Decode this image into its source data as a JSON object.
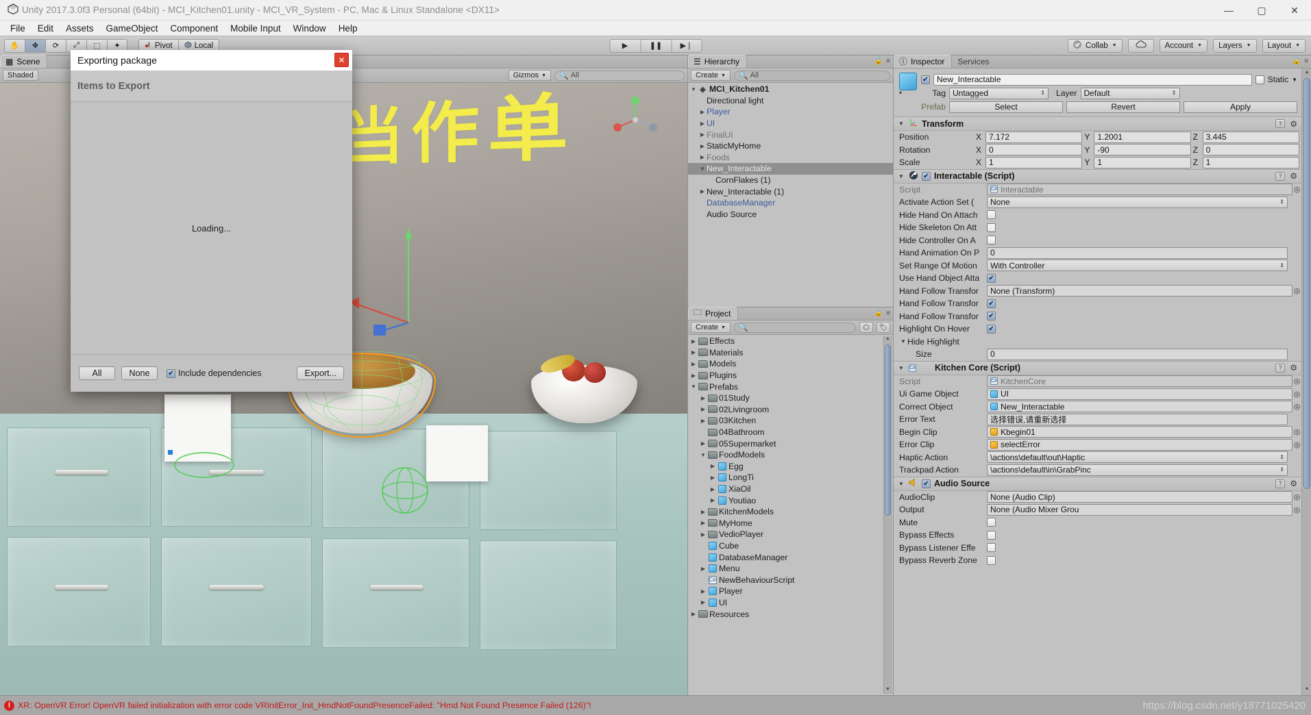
{
  "window": {
    "title": "Unity 2017.3.0f3 Personal (64bit) - MCI_Kitchen01.unity - MCI_VR_System - PC, Mac & Linux Standalone <DX11>",
    "logo_icon": "unity-logo-icon",
    "minimize": "—",
    "maximize": "▢",
    "close": "✕"
  },
  "menubar": [
    "File",
    "Edit",
    "Assets",
    "GameObject",
    "Component",
    "Mobile Input",
    "Window",
    "Help"
  ],
  "toolbar": {
    "tools": [
      {
        "name": "hand-tool",
        "glyph": "✋",
        "active": false
      },
      {
        "name": "move-tool",
        "glyph": "✥",
        "active": true
      },
      {
        "name": "rotate-tool",
        "glyph": "⟳",
        "active": false
      },
      {
        "name": "scale-tool",
        "glyph": "⤢",
        "active": false
      },
      {
        "name": "rect-tool",
        "glyph": "⬚",
        "active": false
      },
      {
        "name": "transform-tool",
        "glyph": "✦",
        "active": false
      }
    ],
    "pivot": "Pivot",
    "local": "Local",
    "play": "▶",
    "pause": "❚❚",
    "step": "▶❘",
    "collab": "Collab",
    "cloud_icon": "cloud-icon",
    "account": "Account",
    "layers": "Layers",
    "layout": "Layout"
  },
  "scene": {
    "tab": "Scene",
    "shading_mode": "Shaded",
    "gizmos": "Gizmos",
    "search_placeholder": "All",
    "wall_text": "一份当作单"
  },
  "hierarchy": {
    "tab": "Hierarchy",
    "create": "Create",
    "search_placeholder": "All",
    "items": [
      {
        "label": "MCI_Kitchen01",
        "depth": 0,
        "arrow": "▼",
        "icon": "unity-scene-icon",
        "style": "root"
      },
      {
        "label": "Directional light",
        "depth": 1,
        "arrow": "",
        "icon": "",
        "style": "normal"
      },
      {
        "label": "Player",
        "depth": 1,
        "arrow": "▶",
        "icon": "",
        "style": "prefab"
      },
      {
        "label": "UI",
        "depth": 1,
        "arrow": "▶",
        "icon": "",
        "style": "prefab"
      },
      {
        "label": "FinalUI",
        "depth": 1,
        "arrow": "▶",
        "icon": "",
        "style": "prefab-dim"
      },
      {
        "label": "StaticMyHome",
        "depth": 1,
        "arrow": "▶",
        "icon": "",
        "style": "normal"
      },
      {
        "label": "Foods",
        "depth": 1,
        "arrow": "▶",
        "icon": "",
        "style": "dim"
      },
      {
        "label": "New_Interactable",
        "depth": 1,
        "arrow": "▼",
        "icon": "",
        "style": "selected"
      },
      {
        "label": "CornFlakes (1)",
        "depth": 2,
        "arrow": "",
        "icon": "",
        "style": "normal"
      },
      {
        "label": "New_Interactable (1)",
        "depth": 1,
        "arrow": "▶",
        "icon": "",
        "style": "normal"
      },
      {
        "label": "DatabaseManager",
        "depth": 1,
        "arrow": "",
        "icon": "",
        "style": "prefab"
      },
      {
        "label": "Audio Source",
        "depth": 1,
        "arrow": "",
        "icon": "",
        "style": "normal"
      }
    ]
  },
  "project": {
    "tab": "Project",
    "create": "Create",
    "search_placeholder": "",
    "items": [
      {
        "label": "Effects",
        "depth": 0,
        "arrow": "▶",
        "icon": "folder"
      },
      {
        "label": "Materials",
        "depth": 0,
        "arrow": "▶",
        "icon": "folder"
      },
      {
        "label": "Models",
        "depth": 0,
        "arrow": "▶",
        "icon": "folder"
      },
      {
        "label": "Plugins",
        "depth": 0,
        "arrow": "▶",
        "icon": "folder"
      },
      {
        "label": "Prefabs",
        "depth": 0,
        "arrow": "▼",
        "icon": "folder"
      },
      {
        "label": "01Study",
        "depth": 1,
        "arrow": "▶",
        "icon": "folder"
      },
      {
        "label": "02Livingroom",
        "depth": 1,
        "arrow": "▶",
        "icon": "folder"
      },
      {
        "label": "03Kitchen",
        "depth": 1,
        "arrow": "▶",
        "icon": "folder"
      },
      {
        "label": "04Bathroom",
        "depth": 1,
        "arrow": "",
        "icon": "folder"
      },
      {
        "label": "05Supermarket",
        "depth": 1,
        "arrow": "▶",
        "icon": "folder"
      },
      {
        "label": "FoodModels",
        "depth": 1,
        "arrow": "▼",
        "icon": "folder"
      },
      {
        "label": "Egg",
        "depth": 2,
        "arrow": "▶",
        "icon": "prefab"
      },
      {
        "label": "LongTi",
        "depth": 2,
        "arrow": "▶",
        "icon": "prefab"
      },
      {
        "label": "XiaOil",
        "depth": 2,
        "arrow": "▶",
        "icon": "prefab"
      },
      {
        "label": "Youtiao",
        "depth": 2,
        "arrow": "▶",
        "icon": "prefab"
      },
      {
        "label": "KitchenModels",
        "depth": 1,
        "arrow": "▶",
        "icon": "folder"
      },
      {
        "label": "MyHome",
        "depth": 1,
        "arrow": "▶",
        "icon": "folder"
      },
      {
        "label": "VedioPlayer",
        "depth": 1,
        "arrow": "▶",
        "icon": "folder"
      },
      {
        "label": "Cube",
        "depth": 1,
        "arrow": "",
        "icon": "prefab"
      },
      {
        "label": "DatabaseManager",
        "depth": 1,
        "arrow": "",
        "icon": "prefab"
      },
      {
        "label": "Menu",
        "depth": 1,
        "arrow": "▶",
        "icon": "prefab"
      },
      {
        "label": "NewBehaviourScript",
        "depth": 1,
        "arrow": "",
        "icon": "script"
      },
      {
        "label": "Player",
        "depth": 1,
        "arrow": "▶",
        "icon": "prefab"
      },
      {
        "label": "UI",
        "depth": 1,
        "arrow": "▶",
        "icon": "prefab"
      },
      {
        "label": "Resources",
        "depth": 0,
        "arrow": "▶",
        "icon": "folder"
      }
    ]
  },
  "inspector": {
    "tab": "Inspector",
    "services_tab": "Services",
    "object_name": "New_Interactable",
    "enabled": true,
    "static_label": "Static",
    "tag_label": "Tag",
    "tag_value": "Untagged",
    "layer_label": "Layer",
    "layer_value": "Default",
    "prefab_label": "Prefab",
    "prefab_buttons": [
      "Select",
      "Revert",
      "Apply"
    ],
    "transform": {
      "title": "Transform",
      "rows": [
        {
          "name": "Position",
          "x": "7.172",
          "y": "1.2001",
          "z": "3.445"
        },
        {
          "name": "Rotation",
          "x": "0",
          "y": "-90",
          "z": "0"
        },
        {
          "name": "Scale",
          "x": "1",
          "y": "1",
          "z": "1"
        }
      ]
    },
    "interactable": {
      "title": "Interactable (Script)",
      "enabled": true,
      "props": [
        {
          "name": "Script",
          "type": "object-dim",
          "value": "Interactable",
          "icon": "script-dim"
        },
        {
          "name": "Activate Action Set (",
          "type": "dropdown",
          "value": "None"
        },
        {
          "name": "Hide Hand On Attach",
          "type": "checkbox",
          "value": false
        },
        {
          "name": "Hide Skeleton On Att",
          "type": "checkbox",
          "value": false
        },
        {
          "name": "Hide Controller On A",
          "type": "checkbox",
          "value": false
        },
        {
          "name": "Hand Animation On P",
          "type": "text",
          "value": "0"
        },
        {
          "name": "Set Range Of Motion",
          "type": "dropdown",
          "value": "With Controller"
        },
        {
          "name": "Use Hand Object Atta",
          "type": "checkbox",
          "value": true
        },
        {
          "name": "Hand Follow Transfor",
          "type": "object",
          "value": "None (Transform)"
        },
        {
          "name": "Hand Follow Transfor",
          "type": "checkbox",
          "value": true
        },
        {
          "name": "Hand Follow Transfor",
          "type": "checkbox",
          "value": true
        },
        {
          "name": "Highlight On Hover",
          "type": "checkbox",
          "value": true
        },
        {
          "name": "Hide Highlight",
          "type": "foldout",
          "value": ""
        },
        {
          "name": "Size",
          "type": "text-indent",
          "value": "0"
        }
      ]
    },
    "kitchen_core": {
      "title": "Kitchen Core (Script)",
      "props": [
        {
          "name": "Script",
          "type": "object-dim",
          "value": "KitchenCore",
          "icon": "script-dim"
        },
        {
          "name": "Ui Game Object",
          "type": "object-cube",
          "value": "UI"
        },
        {
          "name": "Correct Object",
          "type": "object-cube",
          "value": "New_Interactable"
        },
        {
          "name": "Error Text",
          "type": "text",
          "value": "选择错误,请重新选择"
        },
        {
          "name": "Begin Clip",
          "type": "object-audio",
          "value": "Kbegin01"
        },
        {
          "name": "Error Clip",
          "type": "object-audio",
          "value": "selectError"
        },
        {
          "name": "Haptic Action",
          "type": "dropdown",
          "value": "\\actions\\default\\out\\Haptic"
        },
        {
          "name": "Trackpad Action",
          "type": "dropdown",
          "value": "\\actions\\default\\in\\GrabPinc"
        }
      ]
    },
    "audio_source": {
      "title": "Audio Source",
      "enabled": true,
      "props": [
        {
          "name": "AudioClip",
          "type": "object",
          "value": "None (Audio Clip)"
        },
        {
          "name": "Output",
          "type": "object",
          "value": "None (Audio Mixer Grou"
        },
        {
          "name": "Mute",
          "type": "checkbox",
          "value": false
        },
        {
          "name": "Bypass Effects",
          "type": "checkbox",
          "value": false
        },
        {
          "name": "Bypass Listener Effe",
          "type": "checkbox",
          "value": false
        },
        {
          "name": "Bypass Reverb Zone",
          "type": "checkbox",
          "value": false
        }
      ]
    }
  },
  "dialog": {
    "title": "Exporting package",
    "close": "✕",
    "section": "Items to Export",
    "loading": "Loading...",
    "all_button": "All",
    "none_button": "None",
    "include_deps": "Include dependencies",
    "include_deps_checked": true,
    "export_button": "Export..."
  },
  "statusbar": {
    "error_icon": "error-icon",
    "error_badge": "!",
    "message": "XR: OpenVR Error! OpenVR failed initialization with error code VRInitError_Init_HmdNotFoundPresenceFailed: \"Hmd Not Found Presence Failed (126)\"!",
    "watermark": "https://blog.csdn.net/y18771025420"
  }
}
